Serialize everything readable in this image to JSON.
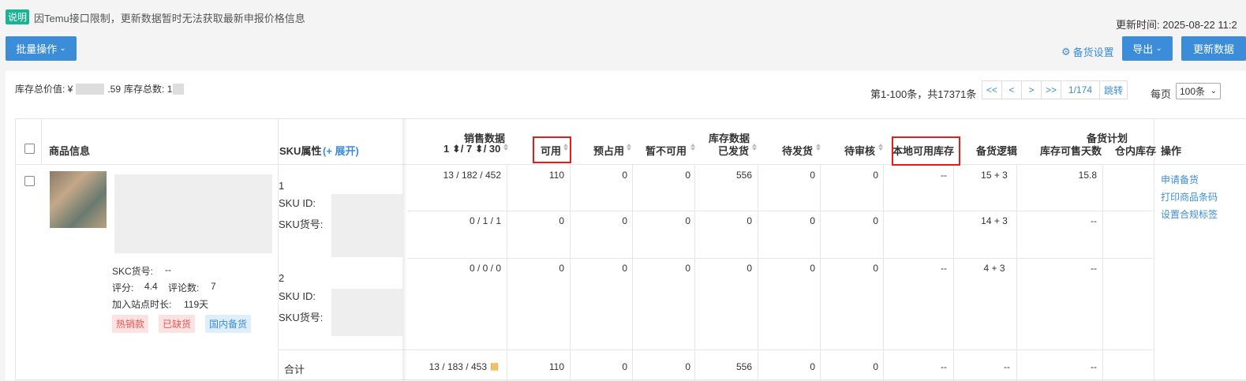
{
  "notice": {
    "tag": "说明",
    "text": "因Temu接口限制，更新数据暂时无法获取最新申报价格信息"
  },
  "update_time": "更新时间: 2025-08-22 11:2",
  "toolbar": {
    "batch_label": "批量操作",
    "stock_settings": "备货设置",
    "export_label": "导出",
    "refresh_label": "更新数据"
  },
  "summary": {
    "value_label": "库存总价值: ¥",
    "value_suffix": ".59",
    "count_label": "库存总数: 1"
  },
  "pager": {
    "info": "第1-100条，共17371条",
    "first": "<<",
    "prev": "<",
    "next": ">",
    "last": ">>",
    "page": "1/174",
    "jump": "跳转",
    "per_page_label": "每页",
    "per_page": "100条"
  },
  "headers": {
    "product": "商品信息",
    "sku_attr": "SKU属性",
    "expand": "(+ 展开)",
    "sales_group": "销售数据",
    "sales_periods": "1 ⬍/ 7 ⬍/ 30",
    "available": "可用",
    "pre_occupied": "预占用",
    "unavailable": "暂不可用",
    "stock_group": "库存数据",
    "shipped": "已发货",
    "pending_ship": "待发货",
    "pending_review": "待审核",
    "local_stock": "本地可用库存",
    "plan_group": "备货计划",
    "logic": "备货逻辑",
    "days": "库存可售天数",
    "warehouse": "仓内库存",
    "actions": "操作"
  },
  "product": {
    "skc_label": "SKC货号:",
    "skc_value": "--",
    "rating_label": "评分:",
    "rating": "4.4",
    "reviews_label": "评论数:",
    "reviews": "7",
    "age_label": "加入站点时长:",
    "age": "119天",
    "tags": [
      "热销款",
      "已缺货",
      "国内备货"
    ]
  },
  "skus": [
    {
      "index": "1",
      "id_label": "SKU ID:",
      "code_label": "SKU货号:"
    },
    {
      "index": "2",
      "id_label": "SKU ID:",
      "code_label": "SKU货号:"
    }
  ],
  "rows": [
    {
      "sales": "13 /  182 /  452",
      "available": "110",
      "pre": "0",
      "unavail": "0",
      "shipped": "556",
      "pending_ship": "0",
      "pending_review": "0",
      "local": "--",
      "logic": "15 + 3",
      "days": "15.8"
    },
    {
      "sales": "0 /  1 /  1",
      "available": "0",
      "pre": "0",
      "unavail": "0",
      "shipped": "0",
      "pending_ship": "0",
      "pending_review": "0",
      "local": "",
      "logic": "14 + 3",
      "days": "--"
    },
    {
      "sales": "0 /  0 /  0",
      "available": "0",
      "pre": "0",
      "unavail": "0",
      "shipped": "0",
      "pending_ship": "0",
      "pending_review": "0",
      "local": "--",
      "logic": "4 + 3",
      "days": "--"
    }
  ],
  "total": {
    "label": "合计",
    "sales": "13 / 183 / 453",
    "available": "110",
    "pre": "0",
    "unavail": "0",
    "shipped": "556",
    "pending_ship": "0",
    "pending_review": "0",
    "local": "--",
    "logic": "--",
    "days": "--"
  },
  "actions": [
    "申请备货",
    "打印商品条码",
    "设置合规标签"
  ],
  "colors": {
    "primary": "#3c8dd9",
    "highlight": "#e01e1e",
    "notice": "#1ab394"
  }
}
